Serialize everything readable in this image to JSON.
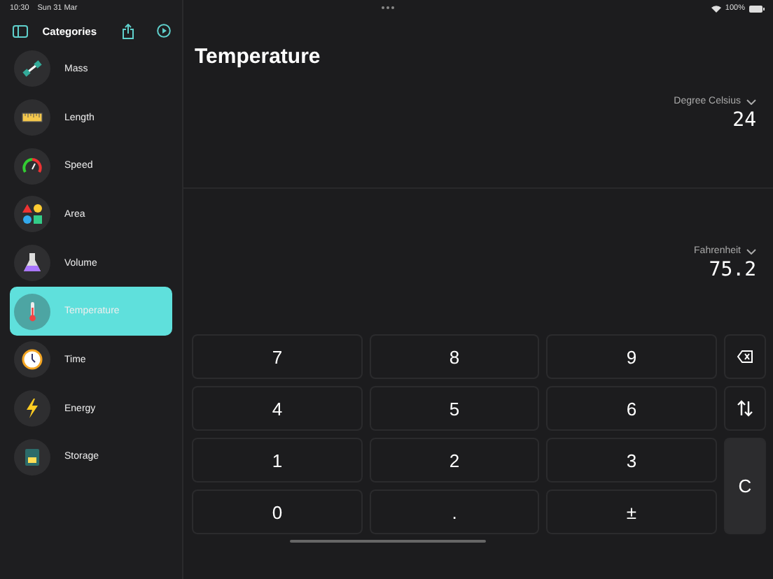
{
  "status_bar": {
    "time": "10:30",
    "date": "Sun 31 Mar",
    "battery": "100%"
  },
  "sidebar": {
    "title": "Categories",
    "items": [
      {
        "label": "Mass",
        "kind": "mass",
        "selected": false
      },
      {
        "label": "Length",
        "kind": "length",
        "selected": false
      },
      {
        "label": "Speed",
        "kind": "speed",
        "selected": false
      },
      {
        "label": "Area",
        "kind": "area",
        "selected": false
      },
      {
        "label": "Volume",
        "kind": "volume",
        "selected": false
      },
      {
        "label": "Temperature",
        "kind": "temperature",
        "selected": true
      },
      {
        "label": "Time",
        "kind": "time",
        "selected": false
      },
      {
        "label": "Energy",
        "kind": "energy",
        "selected": false
      },
      {
        "label": "Storage",
        "kind": "storage",
        "selected": false
      }
    ]
  },
  "main": {
    "title": "Temperature",
    "conversions": [
      {
        "unit": "Degree Celsius",
        "value": "24"
      },
      {
        "unit": "Fahrenheit",
        "value": "75.2"
      }
    ]
  },
  "keypad": [
    {
      "kind": "digit",
      "label": "7"
    },
    {
      "kind": "digit",
      "label": "8"
    },
    {
      "kind": "digit",
      "label": "9"
    },
    {
      "kind": "backspace"
    },
    {
      "kind": "digit",
      "label": "4"
    },
    {
      "kind": "digit",
      "label": "5"
    },
    {
      "kind": "digit",
      "label": "6"
    },
    {
      "kind": "swap"
    },
    {
      "kind": "digit",
      "label": "1"
    },
    {
      "kind": "digit",
      "label": "2"
    },
    {
      "kind": "digit",
      "label": "3"
    },
    {
      "kind": "clear",
      "label": "C"
    },
    {
      "kind": "digit",
      "label": "0"
    },
    {
      "kind": "digit",
      "label": "."
    },
    {
      "kind": "digit",
      "label": "±"
    }
  ]
}
